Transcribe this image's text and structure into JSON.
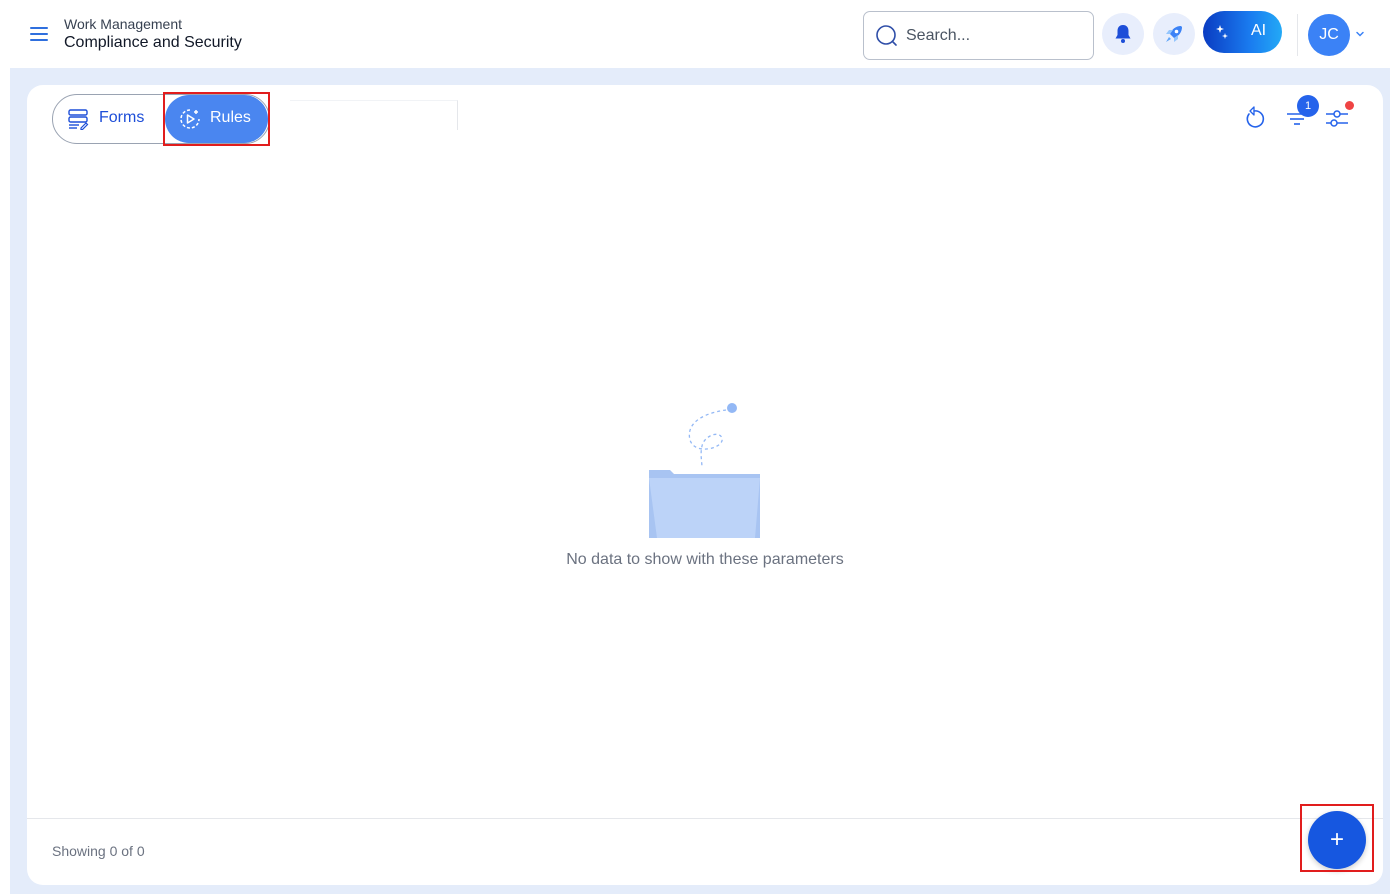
{
  "header": {
    "section": "Work Management",
    "title": "Compliance and Security",
    "search_placeholder": "Search...",
    "ai_label": "AI",
    "avatar_initials": "JC"
  },
  "toolbar": {
    "tabs": [
      {
        "label": "Forms",
        "icon": "form-list-icon",
        "active": false
      },
      {
        "label": "Rules",
        "icon": "rule-play-icon",
        "active": true
      }
    ],
    "filter_count": "1"
  },
  "main": {
    "empty_message": "No data to show with these parameters"
  },
  "footer": {
    "showing": "Showing 0 of 0",
    "add_label": "+"
  },
  "colors": {
    "accent": "#4a86f0",
    "primary": "#1657e0",
    "background": "#e4ecfa",
    "highlight": "#e11d1d"
  }
}
